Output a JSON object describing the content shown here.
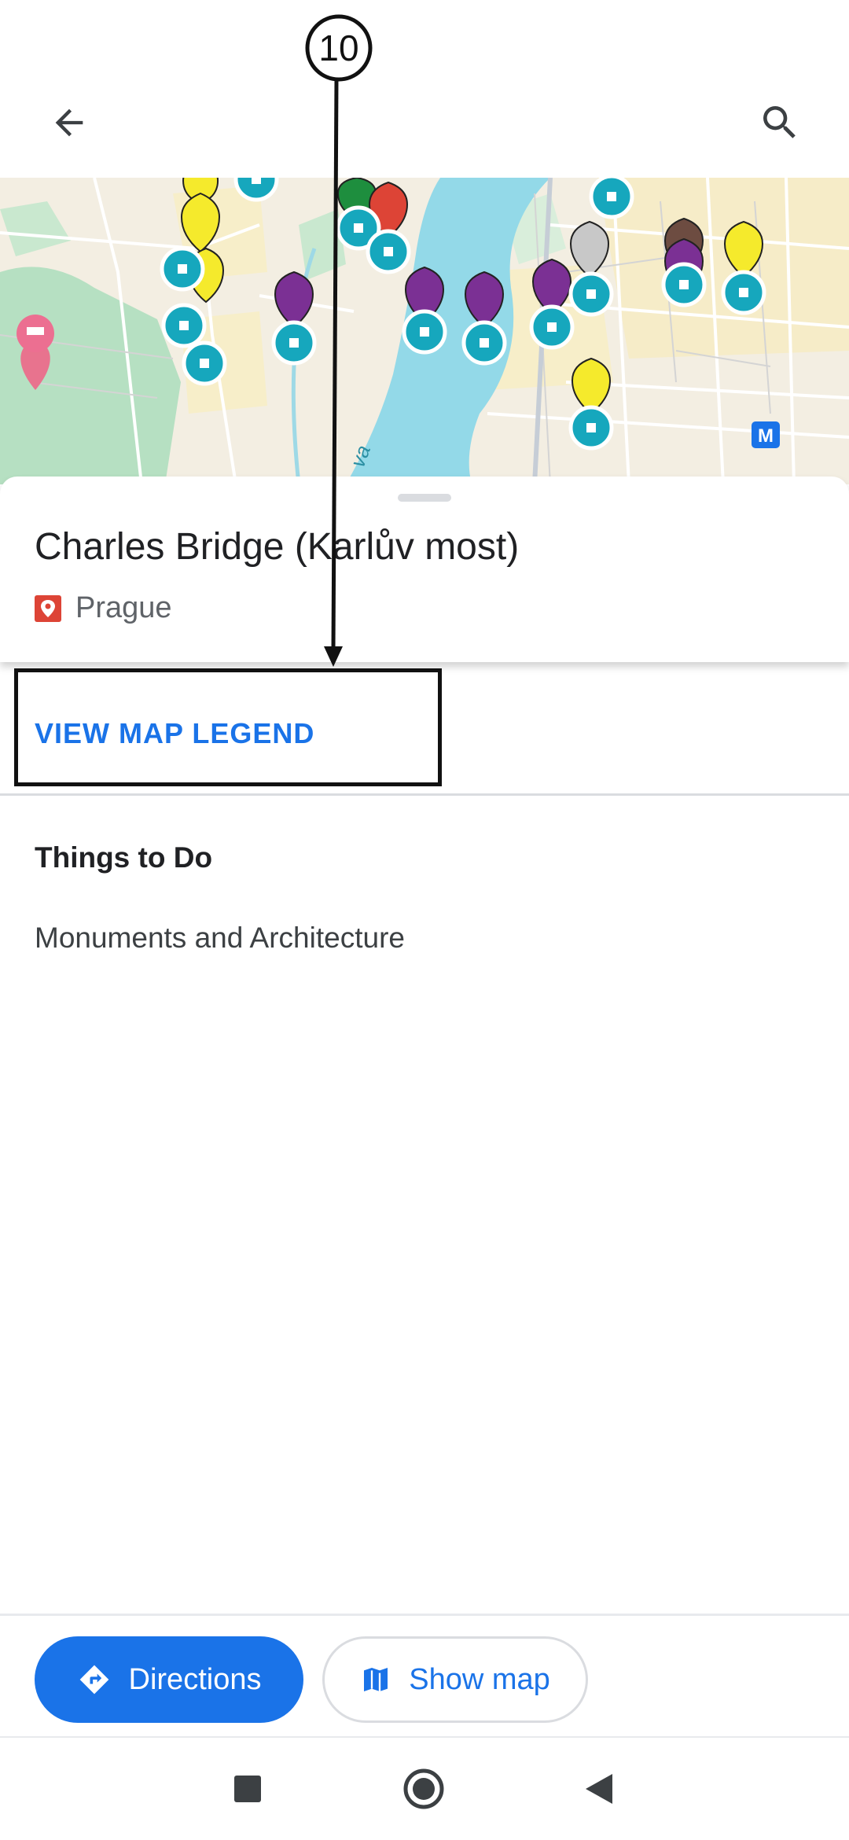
{
  "appbar": {
    "back_icon": "arrow-back-icon",
    "search_icon": "search-icon"
  },
  "map": {
    "metro_badge": "M",
    "river_label": "va",
    "colors": {
      "water": "#93d9e8",
      "park": "#b6e0c2",
      "land": "#f3eee2",
      "marker": "#16a7bd",
      "pin_yellow": "#f5ea2c",
      "pin_purple": "#7b3094",
      "pin_red": "#dd4436",
      "pin_green": "#1e8e3e",
      "pin_gray": "#c8c8c8",
      "pin_brown": "#6d4c41"
    }
  },
  "place": {
    "title": "Charles Bridge (Karlův most)",
    "location": "Prague",
    "location_icon": "place-pin-icon"
  },
  "legend": {
    "link": "VIEW MAP LEGEND"
  },
  "section": {
    "heading": "Things to Do",
    "item": "Monuments and Architecture"
  },
  "actions": {
    "directions": "Directions",
    "directions_icon": "directions-icon",
    "show_map": "Show map",
    "show_map_icon": "map-icon"
  },
  "system_nav": {
    "recents_icon": "square-icon",
    "home_icon": "circle-icon",
    "back_icon": "triangle-back-icon"
  },
  "annotation": {
    "label": "10"
  },
  "colors": {
    "accent": "#1a73e8",
    "text": "#202124",
    "muted": "#5f6368"
  }
}
